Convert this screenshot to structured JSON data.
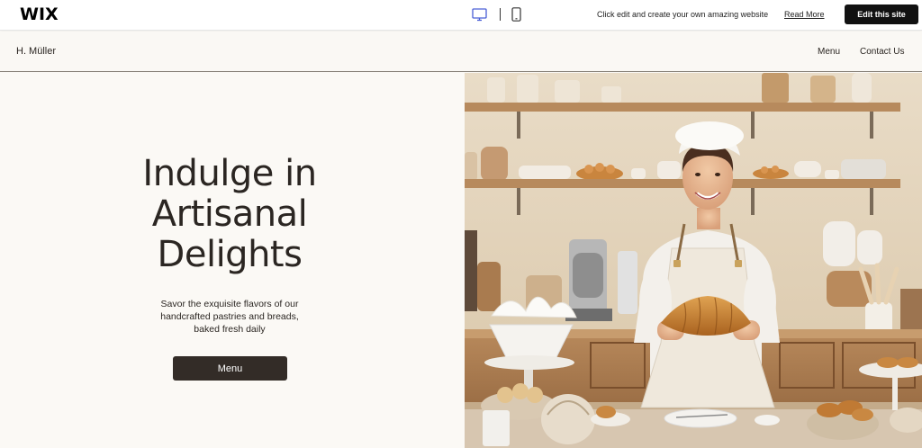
{
  "wix_bar": {
    "logo": "WIX",
    "promo_text": "Click edit and create your own amazing website",
    "read_more": "Read More",
    "edit_button": "Edit this site",
    "icons": [
      "desktop-icon",
      "mobile-icon"
    ]
  },
  "site_header": {
    "brand": "H. Müller",
    "nav": [
      "Menu",
      "Contact Us"
    ]
  },
  "hero": {
    "title_lines": [
      "Indulge in",
      "Artisanal",
      "Delights"
    ],
    "subtitle_lines": [
      "Savor the exquisite flavors of our",
      "handcrafted pastries and breads,",
      "baked fresh daily"
    ],
    "button": "Menu",
    "image_description": "baker-with-croissant"
  },
  "colors": {
    "page_bg": "#faf8f4",
    "text": "#2b2622",
    "button_bg": "#332c27",
    "wix_button_bg": "#111111"
  }
}
